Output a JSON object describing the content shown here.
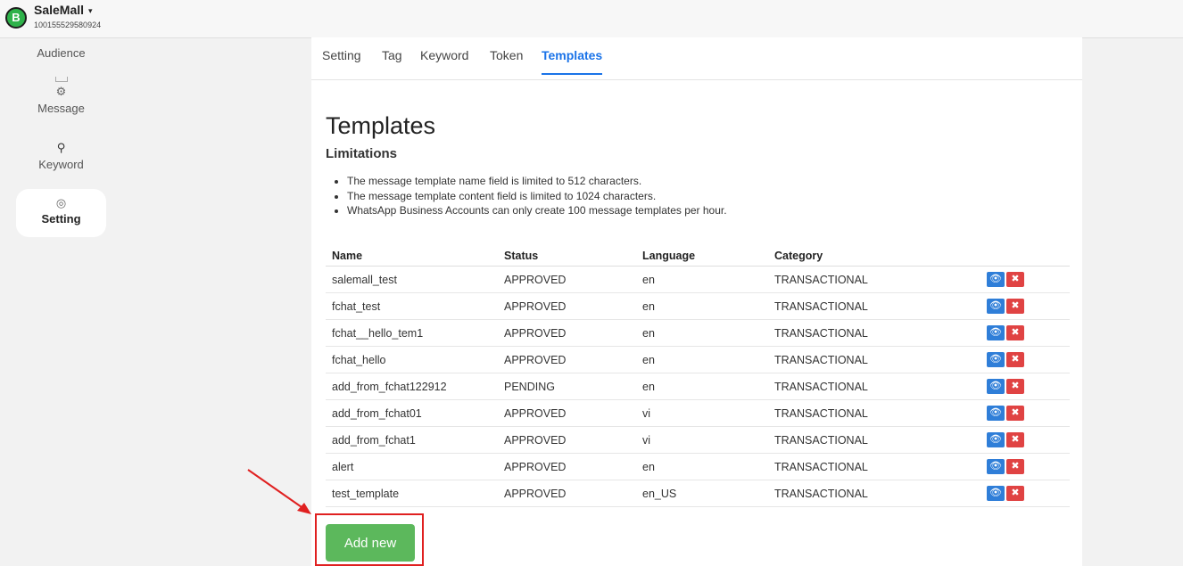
{
  "header": {
    "brand_letter": "B",
    "app_name": "SaleMall",
    "caret": "▾",
    "account_id": "100155529580924"
  },
  "sidebar": {
    "items": [
      {
        "label": "Audience",
        "icon": "users-icon",
        "glyph": ""
      },
      {
        "label": "Message",
        "icon": "message-icon",
        "glyph": "⚙"
      },
      {
        "label": "Keyword",
        "icon": "key-icon",
        "glyph": "⚲"
      },
      {
        "label": "Setting",
        "icon": "settings-icon",
        "glyph": "◎"
      }
    ]
  },
  "tabs": [
    "Setting",
    "Tag",
    "Keyword",
    "Token",
    "Templates"
  ],
  "main": {
    "title": "Templates",
    "subtitle": "Limitations",
    "limits": [
      "The message template name field is limited to 512 characters.",
      "The message template content field is limited to 1024 characters.",
      "WhatsApp Business Accounts can only create 100 message templates per hour."
    ],
    "table": {
      "headers": [
        "Name",
        "Status",
        "Language",
        "Category"
      ],
      "rows": [
        [
          "salemall_test",
          "APPROVED",
          "en",
          "TRANSACTIONAL"
        ],
        [
          "fchat_test",
          "APPROVED",
          "en",
          "TRANSACTIONAL"
        ],
        [
          "fchat__hello_tem1",
          "APPROVED",
          "en",
          "TRANSACTIONAL"
        ],
        [
          "fchat_hello",
          "APPROVED",
          "en",
          "TRANSACTIONAL"
        ],
        [
          "add_from_fchat122912",
          "PENDING",
          "en",
          "TRANSACTIONAL"
        ],
        [
          "add_from_fchat01",
          "APPROVED",
          "vi",
          "TRANSACTIONAL"
        ],
        [
          "add_from_fchat1",
          "APPROVED",
          "vi",
          "TRANSACTIONAL"
        ],
        [
          "alert",
          "APPROVED",
          "en",
          "TRANSACTIONAL"
        ],
        [
          "test_template",
          "APPROVED",
          "en_US",
          "TRANSACTIONAL"
        ]
      ],
      "view_glyph": "👁",
      "delete_glyph": "✖"
    },
    "add_button": "Add new"
  },
  "colors": {
    "accent": "#1a73e8",
    "add_button": "#5cb85c",
    "view": "#2f7ed8",
    "delete": "#e04343",
    "annotation": "#e02020"
  }
}
